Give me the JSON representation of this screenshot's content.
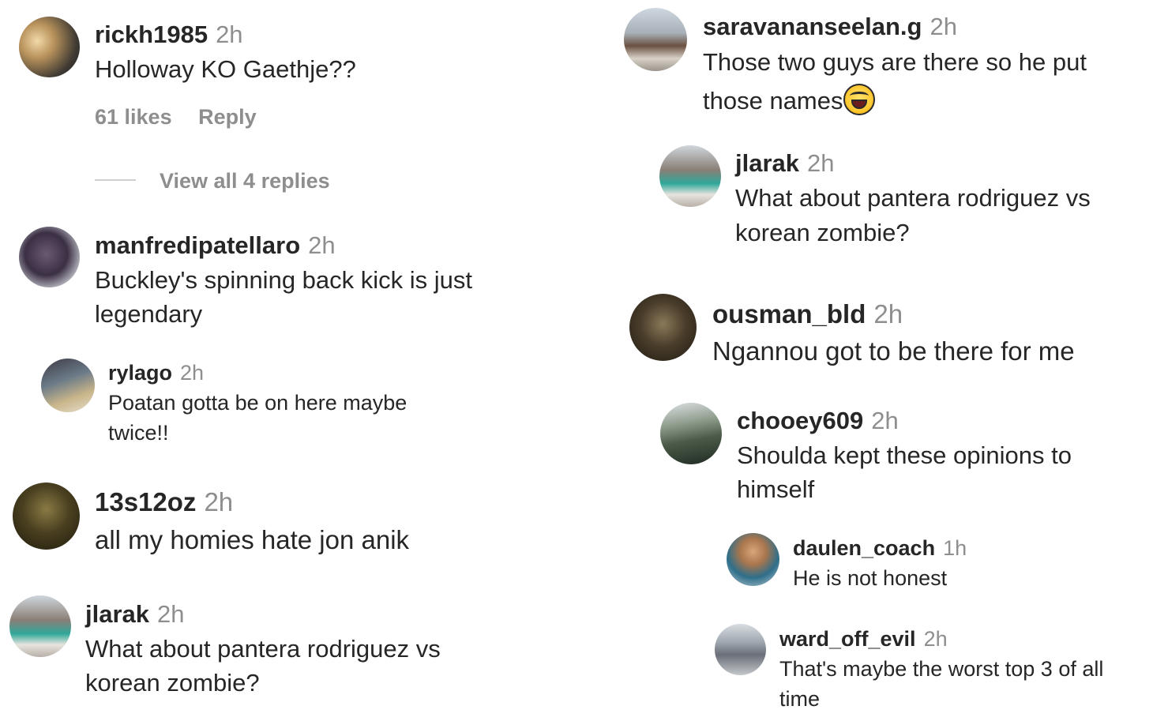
{
  "left": {
    "c1": {
      "user": "rickh1985",
      "time": "2h",
      "text": "Holloway KO Gaethje??",
      "likes": "61 likes",
      "reply": "Reply",
      "view_replies": "View all 4 replies"
    },
    "c2": {
      "user": "manfredipatellaro",
      "time": "2h",
      "line1": "Buckley's spinning back kick is just",
      "line2": "legendary"
    },
    "c3": {
      "user": "rylago",
      "time": "2h",
      "line1": "Poatan gotta be on here maybe",
      "line2": "twice!!"
    },
    "c4": {
      "user": "13s12oz",
      "time": "2h",
      "text": "all my homies hate jon anik"
    },
    "c5": {
      "user": "jlarak",
      "time": "2h",
      "line1": "What about pantera rodriguez vs",
      "line2": "korean zombie?"
    }
  },
  "right": {
    "c1": {
      "user": "saravananseelan.g",
      "time": "2h",
      "line1": "Those two guys are there so he put",
      "line2": "those names",
      "emoji": "face-with-tears-of-joy"
    },
    "c2": {
      "user": "jlarak",
      "time": "2h",
      "line1": "What about pantera rodriguez vs",
      "line2": "korean zombie?"
    },
    "c3": {
      "user": "ousman_bld",
      "time": "2h",
      "text": "Ngannou got to be there for me"
    },
    "c4": {
      "user": "chooey609",
      "time": "2h",
      "line1": "Shoulda kept these opinions to",
      "line2": "himself"
    },
    "c5": {
      "user": "daulen_coach",
      "time": "1h",
      "text": "He is not honest"
    },
    "c6": {
      "user": "ward_off_evil",
      "time": "2h",
      "line1": "That's maybe the worst top 3 of all",
      "line2": "time"
    }
  }
}
